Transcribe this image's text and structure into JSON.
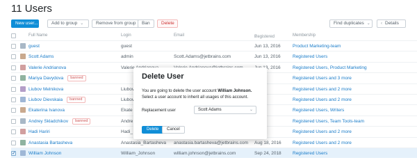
{
  "page": {
    "title": "11 Users"
  },
  "toolbar": {
    "new_user": "New user...",
    "add_to_group": "Add to group",
    "remove_from_group": "Remove from group",
    "ban": "Ban",
    "delete": "Delete",
    "find_duplicates": "Find duplicates",
    "details": "Details"
  },
  "table": {
    "headers": {
      "full_name": "Full Name",
      "login": "Login",
      "email": "Email",
      "registered": "Registered",
      "membership": "Membership"
    },
    "rows": [
      {
        "name": "guest",
        "login": "guest",
        "email": "",
        "registered": "Jun 13, 2016",
        "membership": "Product Marketing-team",
        "banned": ""
      },
      {
        "name": "Scott Adams",
        "login": "admin",
        "email": "Scott.Adams@jetbrains.com",
        "registered": "Jun 13, 2016",
        "membership": "Registered Users",
        "banned": ""
      },
      {
        "name": "Valerie Andrianova",
        "login": "Valerie Andrianova",
        "email": "Valerie.Andrianova@jetbrains.com",
        "registered": "Jun 13, 2016",
        "membership": "Registered Users, Product Marketing",
        "banned": ""
      },
      {
        "name": "Mariya Davydova",
        "login": "",
        "email": "",
        "registered": "",
        "membership": "Registered Users and 3 more",
        "banned": "banned"
      },
      {
        "name": "Liubov Melnikova",
        "login": "Liubov",
        "email": "",
        "registered": "",
        "membership": "Registered Users and 2 more",
        "banned": ""
      },
      {
        "name": "Liubov Dievskaia",
        "login": "Liubov",
        "email": "",
        "registered": "",
        "membership": "Registered Users and 2 more",
        "banned": "banned"
      },
      {
        "name": "Ekaterina Ivanova",
        "login": "Ekate",
        "email": "",
        "registered": "",
        "membership": "Registered Users, Writers",
        "banned": ""
      },
      {
        "name": "Andrey Skladchikov",
        "login": "Andre",
        "email": "",
        "registered": "",
        "membership": "Registered Users, Team Tools-team",
        "banned": "banned"
      },
      {
        "name": "Hadi Hariri",
        "login": "Hadi_",
        "email": "",
        "registered": "",
        "membership": "Registered Users and 2 more",
        "banned": ""
      },
      {
        "name": "Anastasia Bartasheva",
        "login": "Anastasia_Bartasheva",
        "email": "anastasia.bartasheva@jetbrains.com",
        "registered": "Aug 18, 2016",
        "membership": "Registered Users and 2 more",
        "banned": ""
      },
      {
        "name": "William Johnson",
        "login": "William_Johnson",
        "email": "william.johnson@jetbrains.com",
        "registered": "Sep 24, 2018",
        "membership": "Registered Users",
        "banned": ""
      }
    ]
  },
  "dialog": {
    "title": "Delete User",
    "text_before": "You are going to delete the user account ",
    "text_user": "William Johnson.",
    "text_after": " Select a user account to inherit all usages of this account.",
    "replacement_label": "Replacement user",
    "replacement_value": "Scott Adams",
    "delete_button": "Delete",
    "cancel_button": "Cancel"
  }
}
